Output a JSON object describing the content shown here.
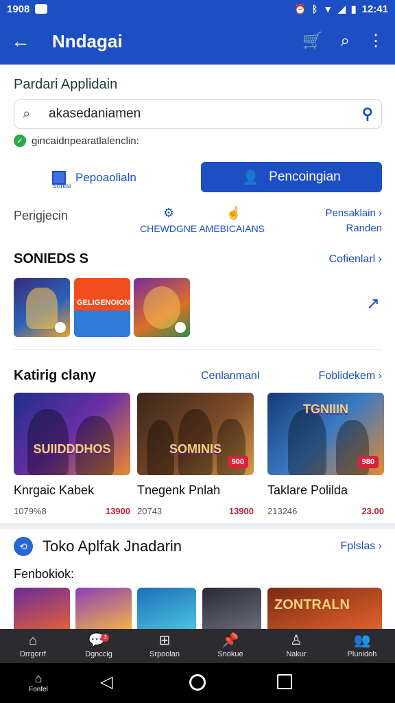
{
  "status_bar": {
    "time_left": "1908",
    "time_right": "12:41",
    "icons": [
      "notification-icon",
      "alarm-icon",
      "bluetooth-icon",
      "wifi-icon",
      "signal-icon",
      "battery-icon"
    ]
  },
  "app_bar": {
    "title": "Nndagai",
    "icons": [
      "back-arrow-icon",
      "store-icon",
      "search-icon",
      "more-vert-icon"
    ]
  },
  "search_section": {
    "title": "Pardari Applidain",
    "search_value": "akasedaniamen",
    "verify_text": "gincaidnpearatlalenclin:"
  },
  "toggle": {
    "left_label": "Pepoaolialn",
    "left_sublabel": "Sonisi",
    "right_label": "Pencoingian"
  },
  "category_row": {
    "left": "Perigjecin",
    "middle": "CHEWDGNE AMEBICAIANS",
    "right_line1": "Pensaklain",
    "right_line2": "Randen"
  },
  "sonieds": {
    "heading": "SONIEDS S",
    "link": "Cofienlarl",
    "thumb2_text": "GELIGENOION"
  },
  "katig": {
    "heading": "Katirig clany",
    "mid_link": "Cenlanmanl",
    "right_link": "Foblidekem",
    "cards": [
      {
        "art_text": "SUIIDDDHOS",
        "name": "Knrgaic Kabek",
        "count": "1079%8",
        "price": "13900",
        "pill": ""
      },
      {
        "art_text": "SOMINIS",
        "name": "Tnegenk Pnlah",
        "count": "20743",
        "price": "13900",
        "pill": "900"
      },
      {
        "art_text": "TGNIIIN",
        "name": "Taklare Polilda",
        "count": "213246",
        "price": "23.00",
        "pill": "980"
      }
    ]
  },
  "toko": {
    "heading": "Toko Aplfak Jnadarin",
    "link": "Fplslas",
    "sub": "Fenbokiok:",
    "banner_text": "ZONTRALN"
  },
  "bottom_nav": [
    {
      "label": "Drrgorrf",
      "icon": "home-icon"
    },
    {
      "label": "Dgnccig",
      "icon": "chat-icon",
      "badge": "3"
    },
    {
      "label": "Srpoolan",
      "icon": "grid-icon"
    },
    {
      "label": "Snokue",
      "icon": "pin-icon"
    },
    {
      "label": "Nakur",
      "icon": "person-icon"
    },
    {
      "label": "Plunidoh",
      "icon": "group-icon"
    }
  ],
  "system_nav": {
    "home_label": "Fonfel"
  }
}
